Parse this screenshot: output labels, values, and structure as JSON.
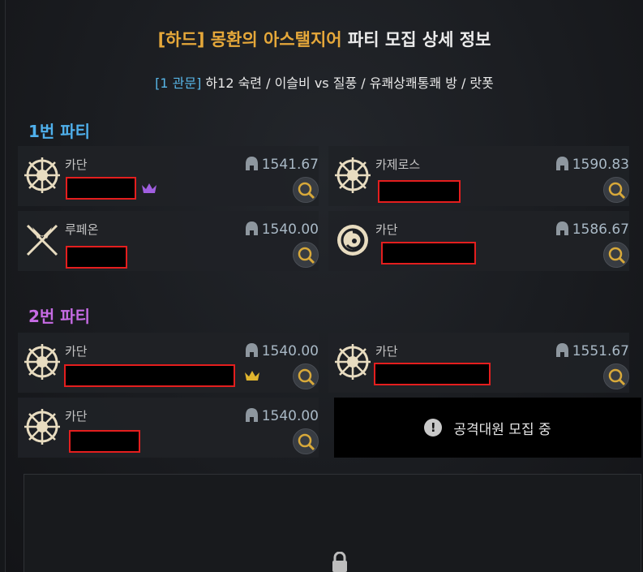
{
  "header": {
    "title_highlight": "[하드] 몽환의 아스탤지어",
    "title_rest": "파티 모집 상세 정보",
    "subtitle_highlight": "[1 관문]",
    "subtitle_rest": "하12 숙련 / 이슬비 vs 질풍 / 유쾌상쾌통쾌 방 / 랏폿"
  },
  "parties": [
    {
      "title": "1번 파티",
      "color": "#4fb0ec",
      "members": [
        {
          "class": "카단",
          "item_level": "1541.67",
          "icon": "sunburst-emblem-icon",
          "leader": true,
          "crown_color": "#a05ee0"
        },
        {
          "class": "카제로스",
          "item_level": "1590.83",
          "icon": "sunburst-emblem-icon",
          "leader": false
        },
        {
          "class": "루페온",
          "item_level": "1540.00",
          "icon": "crossed-blades-icon",
          "leader": false
        },
        {
          "class": "카단",
          "item_level": "1586.67",
          "icon": "swirl-emblem-icon",
          "leader": false
        }
      ]
    },
    {
      "title": "2번 파티",
      "color": "#c66be4",
      "members": [
        {
          "class": "카단",
          "item_level": "1540.00",
          "icon": "sunburst-emblem-icon",
          "leader": true,
          "crown_color": "#e0b52e"
        },
        {
          "class": "카단",
          "item_level": "1551.67",
          "icon": "sunburst-emblem-icon",
          "leader": false
        },
        {
          "class": "카단",
          "item_level": "1540.00",
          "icon": "sunburst-emblem-icon",
          "leader": false
        }
      ],
      "open_slot": {
        "text": "공격대원 모집 중",
        "icon": "alert-icon"
      }
    }
  ],
  "locked_panel": {
    "icon": "lock-icon"
  }
}
